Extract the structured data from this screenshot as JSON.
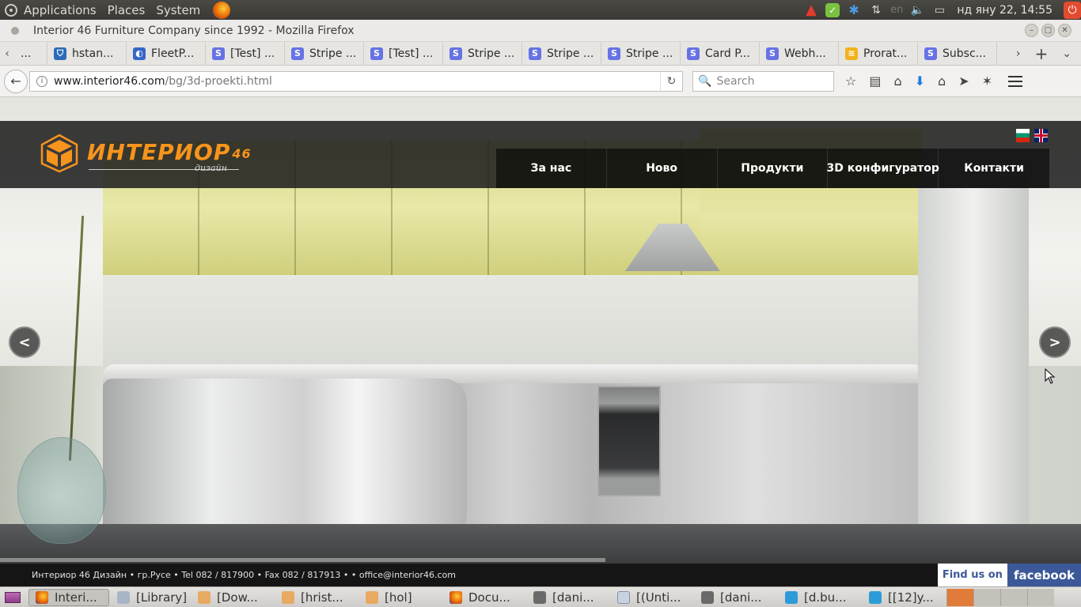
{
  "os_panel": {
    "menus": [
      "Applications",
      "Places",
      "System"
    ],
    "keyboard_layout": "en",
    "clock": "нд яну 22, 14:55"
  },
  "window": {
    "title": "Interior 46 Furniture Company since 1992 - Mozilla Firefox"
  },
  "tabs": [
    {
      "label": "...",
      "icon": "generic"
    },
    {
      "label": "hstan...",
      "icon": "shield"
    },
    {
      "label": "FleetP...",
      "icon": "fleet"
    },
    {
      "label": "[Test] ...",
      "icon": "stripe"
    },
    {
      "label": "Stripe ...",
      "icon": "stripe"
    },
    {
      "label": "[Test] ...",
      "icon": "stripe"
    },
    {
      "label": "Stripe ...",
      "icon": "stripe"
    },
    {
      "label": "Stripe ...",
      "icon": "stripe"
    },
    {
      "label": "Stripe ...",
      "icon": "stripe"
    },
    {
      "label": "Card P...",
      "icon": "stripe"
    },
    {
      "label": "Webh...",
      "icon": "stripe"
    },
    {
      "label": "Prorat...",
      "icon": "prorate"
    },
    {
      "label": "Subsc...",
      "icon": "stripe"
    }
  ],
  "navbar": {
    "url_host": "www.interior46.com",
    "url_path": "/bg/3d-proekti.html",
    "search_placeholder": "Search"
  },
  "site": {
    "logo_main": "ИНТЕРИОР",
    "logo_num": "46",
    "logo_sub": "дизайн",
    "nav": [
      "За нас",
      "Ново",
      "Продукти",
      "3D конфигуратор",
      "Контакти"
    ],
    "slider_prev": "<",
    "slider_next": ">",
    "slider_progress": 0.56,
    "footer_text": "Интериор 46 Дизайн • гр.Русе • Tel 082 / 817900 • Fax 082 / 817913 • • office@interior46.com",
    "fb_find": "Find us on",
    "fb_logo": "facebook"
  },
  "taskbar": [
    {
      "label": "Interi...",
      "icon": "firefox",
      "active": true
    },
    {
      "label": "[Library]",
      "icon": "library"
    },
    {
      "label": "[Dow...",
      "icon": "folder"
    },
    {
      "label": "[hrist...",
      "icon": "folder"
    },
    {
      "label": "[hol]",
      "icon": "folder"
    },
    {
      "label": "Docu...",
      "icon": "firefox"
    },
    {
      "label": "[dani...",
      "icon": "terminal"
    },
    {
      "label": "[(Unti...",
      "icon": "libreoffice"
    },
    {
      "label": "[dani...",
      "icon": "terminal"
    },
    {
      "label": "[d.bu...",
      "icon": "skype"
    },
    {
      "label": "[[12]y...",
      "icon": "skype"
    }
  ],
  "colors": {
    "brand_orange": "#f7941d",
    "facebook_blue": "#3b5998",
    "stripe_purple": "#6772e5"
  }
}
